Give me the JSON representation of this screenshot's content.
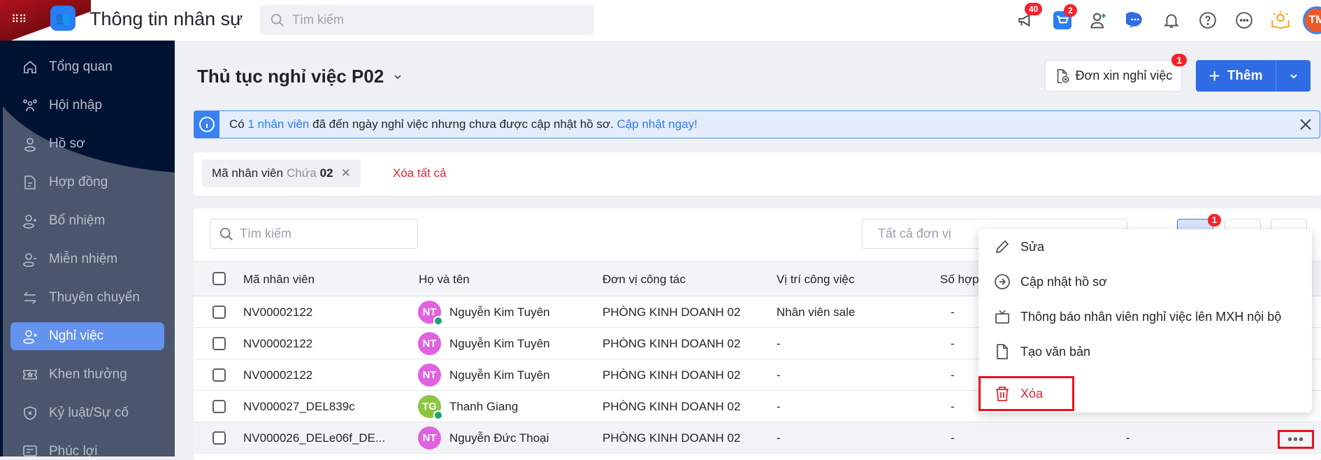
{
  "app": {
    "title": "Thông tin nhân sự",
    "search_placeholder": "Tìm kiếm"
  },
  "topbar": {
    "announce_badge": "40",
    "cart_badge": "2",
    "avatar_initials": "TM"
  },
  "sidebar": {
    "items": [
      {
        "label": "Tổng quan",
        "icon": "home-icon"
      },
      {
        "label": "Hội nhập",
        "icon": "group-icon"
      },
      {
        "label": "Hồ sơ",
        "icon": "user-icon"
      },
      {
        "label": "Hợp đồng",
        "icon": "document-icon"
      },
      {
        "label": "Bổ nhiệm",
        "icon": "user-plus-icon"
      },
      {
        "label": "Miễn nhiệm",
        "icon": "user-minus-icon"
      },
      {
        "label": "Thuyên chuyển",
        "icon": "transfer-icon"
      },
      {
        "label": "Nghỉ việc",
        "icon": "user-x-icon",
        "active": true
      },
      {
        "label": "Khen thưởng",
        "icon": "ticket-star-icon"
      },
      {
        "label": "Kỷ luật/Sự cố",
        "icon": "shield-x-icon"
      },
      {
        "label": "Phúc lợi",
        "icon": "benefit-icon"
      }
    ]
  },
  "main": {
    "title": "Thủ tục nghỉ việc P02",
    "leave_request_label": "Đơn xin nghỉ việc",
    "leave_request_badge": "1",
    "add_label": "Thêm",
    "alert": {
      "prefix": "Có",
      "link": "1 nhân viên",
      "middle": "đã đến ngày nghỉ việc nhưng chưa được cập nhật hồ sơ.",
      "action": "Cập nhật ngay!"
    },
    "filter": {
      "field": "Mã nhân viên",
      "op": "Chứa",
      "value": "02",
      "clear_all": "Xóa tất cả"
    },
    "table_search_placeholder": "Tìm kiếm",
    "unit_placeholder": "Tất cả đơn vị",
    "toolbar_badge": "1",
    "columns": [
      "Mã nhân viên",
      "Họ và tên",
      "Đơn vị công tác",
      "Vị trí công việc",
      "Số hợp"
    ],
    "rows": [
      {
        "code": "NV00002122",
        "initials": "NT",
        "name": "Nguyễn Kim Tuyên",
        "unit": "PHÒNG KINH DOANH 02",
        "position": "Nhân viên sale",
        "contract": "-",
        "extra": ""
      },
      {
        "code": "NV00002122",
        "initials": "NT",
        "name": "Nguyễn Kim Tuyên",
        "unit": "PHÒNG KINH DOANH 02",
        "position": "-",
        "contract": "-",
        "extra": ""
      },
      {
        "code": "NV00002122",
        "initials": "NT",
        "name": "Nguyễn Kim Tuyên",
        "unit": "PHÒNG KINH DOANH 02",
        "position": "-",
        "contract": "-",
        "extra": ""
      },
      {
        "code": "NV000027_DEL839c",
        "initials": "TG",
        "name": "Thanh Giang",
        "unit": "PHÒNG KINH DOANH 02",
        "position": "-",
        "contract": "-",
        "extra": ""
      },
      {
        "code": "NV000026_DELe06f_DE...",
        "initials": "NT",
        "name": "Nguyễn Đức Thoại",
        "unit": "PHÒNG KINH DOANH 02",
        "position": "-",
        "contract": "-",
        "extra": "-"
      }
    ],
    "context_menu": [
      "Sửa",
      "Cập nhật hồ sơ",
      "Thông báo nhân viên nghỉ việc lên MXH nội bộ",
      "Tạo văn bản",
      "Xóa"
    ],
    "more_label": "•••"
  },
  "colors": {
    "accent": "#2f6be4",
    "danger": "#e6242e",
    "avatar_pink": "#e062e0",
    "avatar_green": "#8cc63f"
  }
}
